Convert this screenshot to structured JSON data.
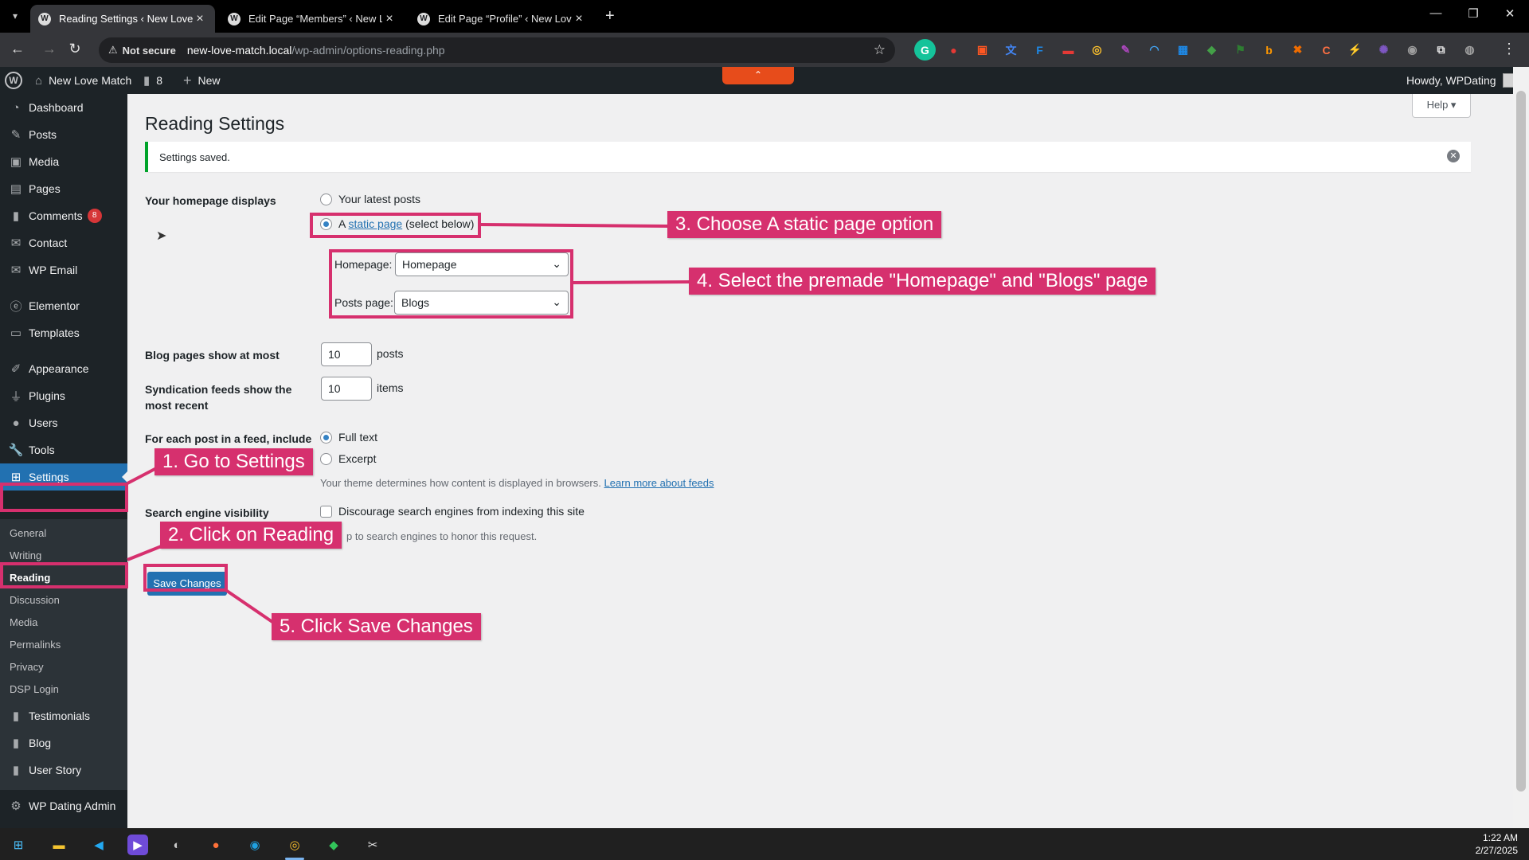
{
  "browser": {
    "tabs": [
      {
        "title": "Reading Settings ‹ New Love M",
        "active": true
      },
      {
        "title": "Edit Page “Members” ‹ New Lo",
        "active": false
      },
      {
        "title": "Edit Page “Profile” ‹ New Love M",
        "active": false
      }
    ],
    "new_tab": "+",
    "security_label": "Not secure",
    "url_host": "new-love-match.local",
    "url_path": "/wp-admin/options-reading.php"
  },
  "admin_bar": {
    "site_name": "New Love Match",
    "comments_count": "8",
    "new_label": "New",
    "howdy": "Howdy, WPDating"
  },
  "sidebar": {
    "items": [
      {
        "label": "Dashboard",
        "icon": "dashboard-icon"
      },
      {
        "label": "Posts",
        "icon": "pin-icon"
      },
      {
        "label": "Media",
        "icon": "media-icon"
      },
      {
        "label": "Pages",
        "icon": "pages-icon"
      },
      {
        "label": "Comments",
        "icon": "comment-icon",
        "badge": "8"
      },
      {
        "label": "Contact",
        "icon": "mail-icon"
      },
      {
        "label": "WP Email",
        "icon": "mail-icon"
      },
      {
        "label": "Elementor",
        "icon": "elementor-icon"
      },
      {
        "label": "Templates",
        "icon": "folder-icon"
      },
      {
        "label": "Appearance",
        "icon": "brush-icon"
      },
      {
        "label": "Plugins",
        "icon": "plugin-icon"
      },
      {
        "label": "Users",
        "icon": "user-icon"
      },
      {
        "label": "Tools",
        "icon": "wrench-icon"
      },
      {
        "label": "Settings",
        "icon": "settings-icon"
      }
    ],
    "submenu": [
      "General",
      "Writing",
      "Reading",
      "Discussion",
      "Media",
      "Permalinks",
      "Privacy",
      "DSP Login"
    ],
    "bottom_items": [
      {
        "label": "Testimonials",
        "icon": "comment-icon"
      },
      {
        "label": "Blog",
        "icon": "comment-icon"
      },
      {
        "label": "User Story",
        "icon": "comment-icon"
      },
      {
        "label": "WP Dating Admin",
        "icon": "gear-icon"
      }
    ]
  },
  "main": {
    "help_label": "Help ▾",
    "title": "Reading Settings",
    "notice": "Settings saved.",
    "homepage_displays": {
      "label": "Your homepage displays",
      "option_latest": "Your latest posts",
      "option_static_prefix": "A ",
      "option_static_link": "static page",
      "option_static_suffix": " (select below)",
      "selected": "static page"
    },
    "homepage_select": {
      "label": "Homepage:",
      "value": "Homepage"
    },
    "posts_page_select": {
      "label": "Posts page:",
      "value": "Blogs"
    },
    "blog_pages": {
      "label": "Blog pages show at most",
      "value": "10",
      "unit": "posts"
    },
    "syndication": {
      "label_line1": "Syndication feeds show the",
      "label_line2": "most recent",
      "value": "10",
      "unit": "items"
    },
    "feed_content": {
      "label": "For each post in a feed, include",
      "option_full": "Full text",
      "option_excerpt": "Excerpt",
      "selected": "Full text",
      "note": "Your theme determines how content is displayed in browsers. ",
      "note_link": "Learn more about feeds"
    },
    "search_visibility": {
      "label": "Search engine visibility",
      "checkbox_label": "Discourage search engines from indexing this site",
      "checked": false,
      "note": "p to search engines to honor this request."
    },
    "save_label": "Save Changes"
  },
  "annotations": {
    "step1": "1. Go to Settings",
    "step2": "2. Click on Reading",
    "step3": "3. Choose A static page option",
    "step4": "4. Select the premade \"Homepage\" and \"Blogs\" page",
    "step5": "5. Click Save Changes",
    "color": "#d6306e"
  },
  "taskbar": {
    "time": "1:22 AM",
    "date": "2/27/2025"
  },
  "colors": {
    "wp_blue": "#2271b1",
    "admin_dark": "#1d2327",
    "notice_green": "#00a32a",
    "badge_red": "#d63638"
  }
}
